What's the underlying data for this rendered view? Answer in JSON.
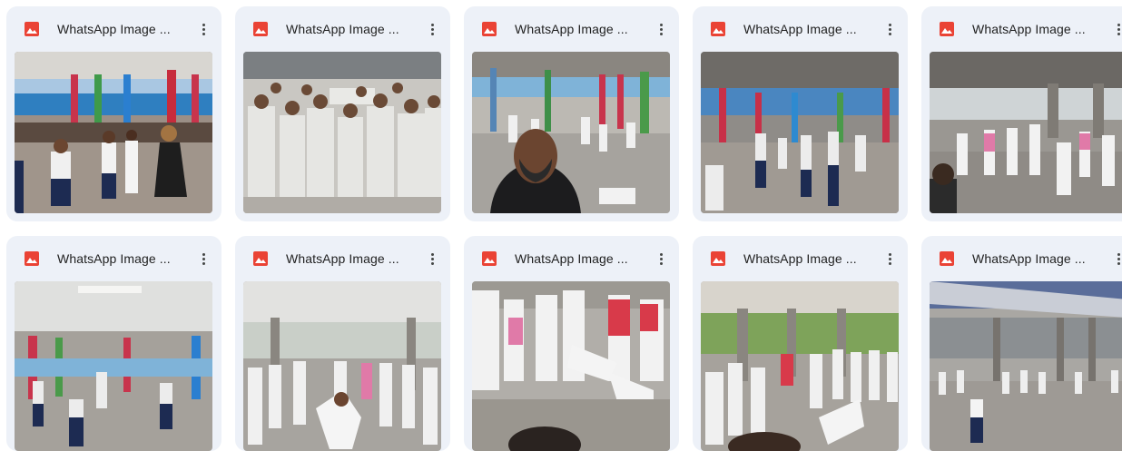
{
  "files": [
    {
      "name": "WhatsApp Image ...",
      "icon": "image-file-icon",
      "scene": "gym-kids-teacher"
    },
    {
      "name": "WhatsApp Image ...",
      "icon": "image-file-icon",
      "scene": "group-photo"
    },
    {
      "name": "WhatsApp Image ...",
      "icon": "image-file-icon",
      "scene": "selfie-man"
    },
    {
      "name": "WhatsApp Image ...",
      "icon": "image-file-icon",
      "scene": "hall-kids-pillars"
    },
    {
      "name": "WhatsApp Image ...",
      "icon": "image-file-icon",
      "scene": "circle-kids"
    },
    {
      "name": "WhatsApp Image ...",
      "icon": "image-file-icon",
      "scene": "hall-fight"
    },
    {
      "name": "WhatsApp Image ...",
      "icon": "image-file-icon",
      "scene": "roda-capoeira"
    },
    {
      "name": "WhatsApp Image ...",
      "icon": "image-file-icon",
      "scene": "kick-closeup"
    },
    {
      "name": "WhatsApp Image ...",
      "icon": "image-file-icon",
      "scene": "roda-trees"
    },
    {
      "name": "WhatsApp Image ...",
      "icon": "image-file-icon",
      "scene": "wide-hall"
    }
  ],
  "colors": {
    "card_bg": "#edf1f8",
    "icon_red": "#ea4335",
    "text": "#1f1f1f"
  }
}
